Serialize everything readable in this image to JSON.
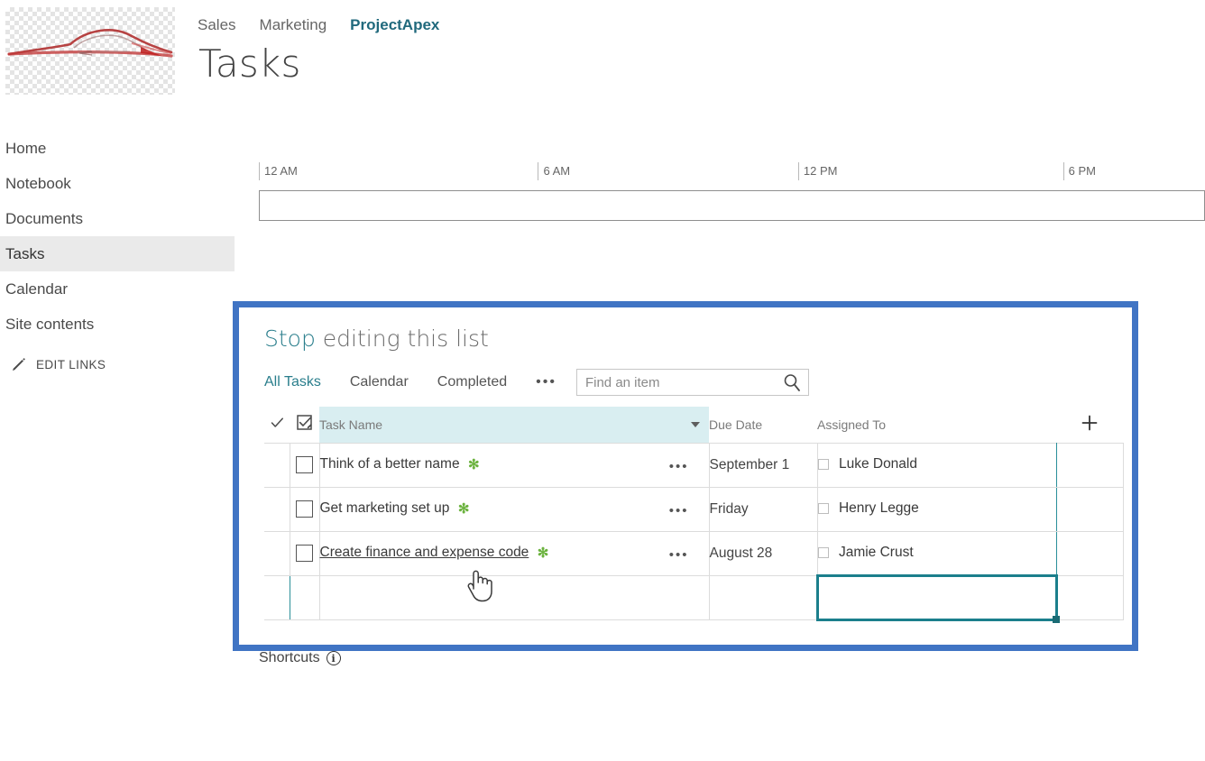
{
  "header": {
    "logo_alt": "car-sketch-logo",
    "nav_tabs": [
      {
        "label": "Sales",
        "active": false
      },
      {
        "label": "Marketing",
        "active": false
      },
      {
        "label": "ProjectApex",
        "active": true
      }
    ],
    "page_title": "Tasks",
    "accent_teal": "#20697c"
  },
  "sidebar": {
    "items": [
      {
        "label": "Home",
        "selected": false
      },
      {
        "label": "Notebook",
        "selected": false
      },
      {
        "label": "Documents",
        "selected": false
      },
      {
        "label": "Tasks",
        "selected": true
      },
      {
        "label": "Calendar",
        "selected": false
      },
      {
        "label": "Site contents",
        "selected": false
      }
    ],
    "edit_links_label": "EDIT LINKS",
    "edit_links_icon": "pencil-icon"
  },
  "timeline": {
    "ticks": [
      {
        "label": "12 AM",
        "left_pct": 0
      },
      {
        "label": "6 AM",
        "left_pct": 29.5
      },
      {
        "label": "12 PM",
        "left_pct": 57.0
      },
      {
        "label": "6 PM",
        "left_pct": 85.0
      }
    ]
  },
  "edit_panel": {
    "border_color": "#4074c4",
    "heading_link": "Stop",
    "heading_rest": " editing this list",
    "views": [
      {
        "label": "All Tasks",
        "active": true
      },
      {
        "label": "Calendar",
        "active": false
      },
      {
        "label": "Completed",
        "active": false
      }
    ],
    "views_overflow": "•••",
    "search": {
      "placeholder": "Find an item",
      "value": "",
      "icon": "search-icon"
    },
    "grid": {
      "columns": [
        {
          "key": "check",
          "label": "",
          "icon": "checkmark-icon"
        },
        {
          "key": "select",
          "label": "",
          "icon": "checkbox-edit-icon"
        },
        {
          "key": "name",
          "label": "Task Name",
          "highlighted": true,
          "sortable": true
        },
        {
          "key": "due",
          "label": "Due Date"
        },
        {
          "key": "assigned",
          "label": "Assigned To"
        },
        {
          "key": "add",
          "label": "",
          "icon": "plus-icon"
        }
      ],
      "highlight_color": "#d9eef1",
      "selection_color": "#1b7f8c",
      "new_marker": "✻",
      "row_menu": "•••",
      "rows": [
        {
          "task_name": "Think of a better name",
          "is_new": true,
          "hovered": false,
          "due_date": "September 1",
          "assigned_to": "Luke Donald"
        },
        {
          "task_name": "Get marketing set up",
          "is_new": true,
          "hovered": false,
          "due_date": "Friday",
          "assigned_to": "Henry Legge"
        },
        {
          "task_name": "Create finance and expense code",
          "is_new": true,
          "hovered": true,
          "due_date": "August 28",
          "assigned_to": "Jamie Crust"
        }
      ],
      "new_row": {
        "task_name": "",
        "due_date": "",
        "assigned_to": "",
        "selected_cell": "assigned"
      }
    }
  },
  "footer": {
    "shortcuts_label": "Shortcuts",
    "shortcuts_icon": "info-icon"
  }
}
